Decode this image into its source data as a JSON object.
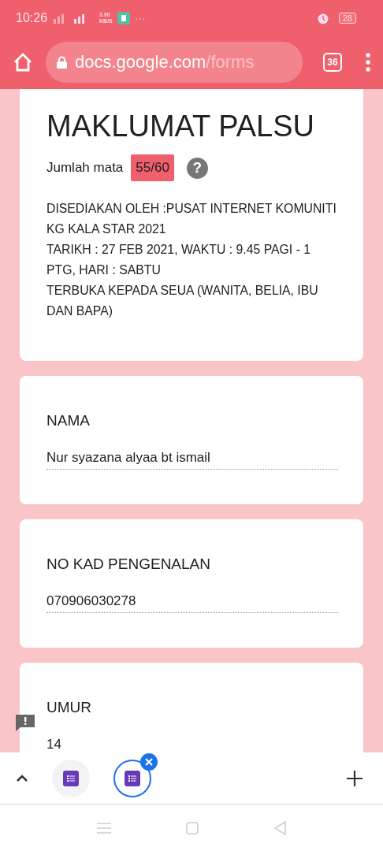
{
  "status_bar": {
    "time": "10:26",
    "speed": [
      "3.00",
      "KB/S"
    ],
    "more": "···",
    "battery": "28"
  },
  "browser": {
    "url_host": "docs.google.com",
    "url_path": "/forms",
    "tab_count": "36"
  },
  "header_card": {
    "title": "MAKLUMAT PALSU",
    "score_label": "Jumlah mata",
    "score": "55/60",
    "help": "?",
    "description": [
      "DISEDIAKAN OLEH :PUSAT INTERNET KOMUNITI KG KALA STAR 2021",
      "TARIKH : 27 FEB 2021, WAKTU : 9.45 PAGI - 1 PTG, HARI : SABTU",
      "TERBUKA KEPADA SEUA  (WANITA, BELIA, IBU DAN BAPA)"
    ]
  },
  "questions": [
    {
      "label": "NAMA",
      "value": "Nur syazana alyaa bt ismail"
    },
    {
      "label": "NO KAD PENGENALAN",
      "value": "070906030278"
    },
    {
      "label": "UMUR",
      "value": "14"
    }
  ],
  "tab_strip": {
    "tabs": [
      {
        "selected": false
      },
      {
        "selected": true
      }
    ]
  }
}
